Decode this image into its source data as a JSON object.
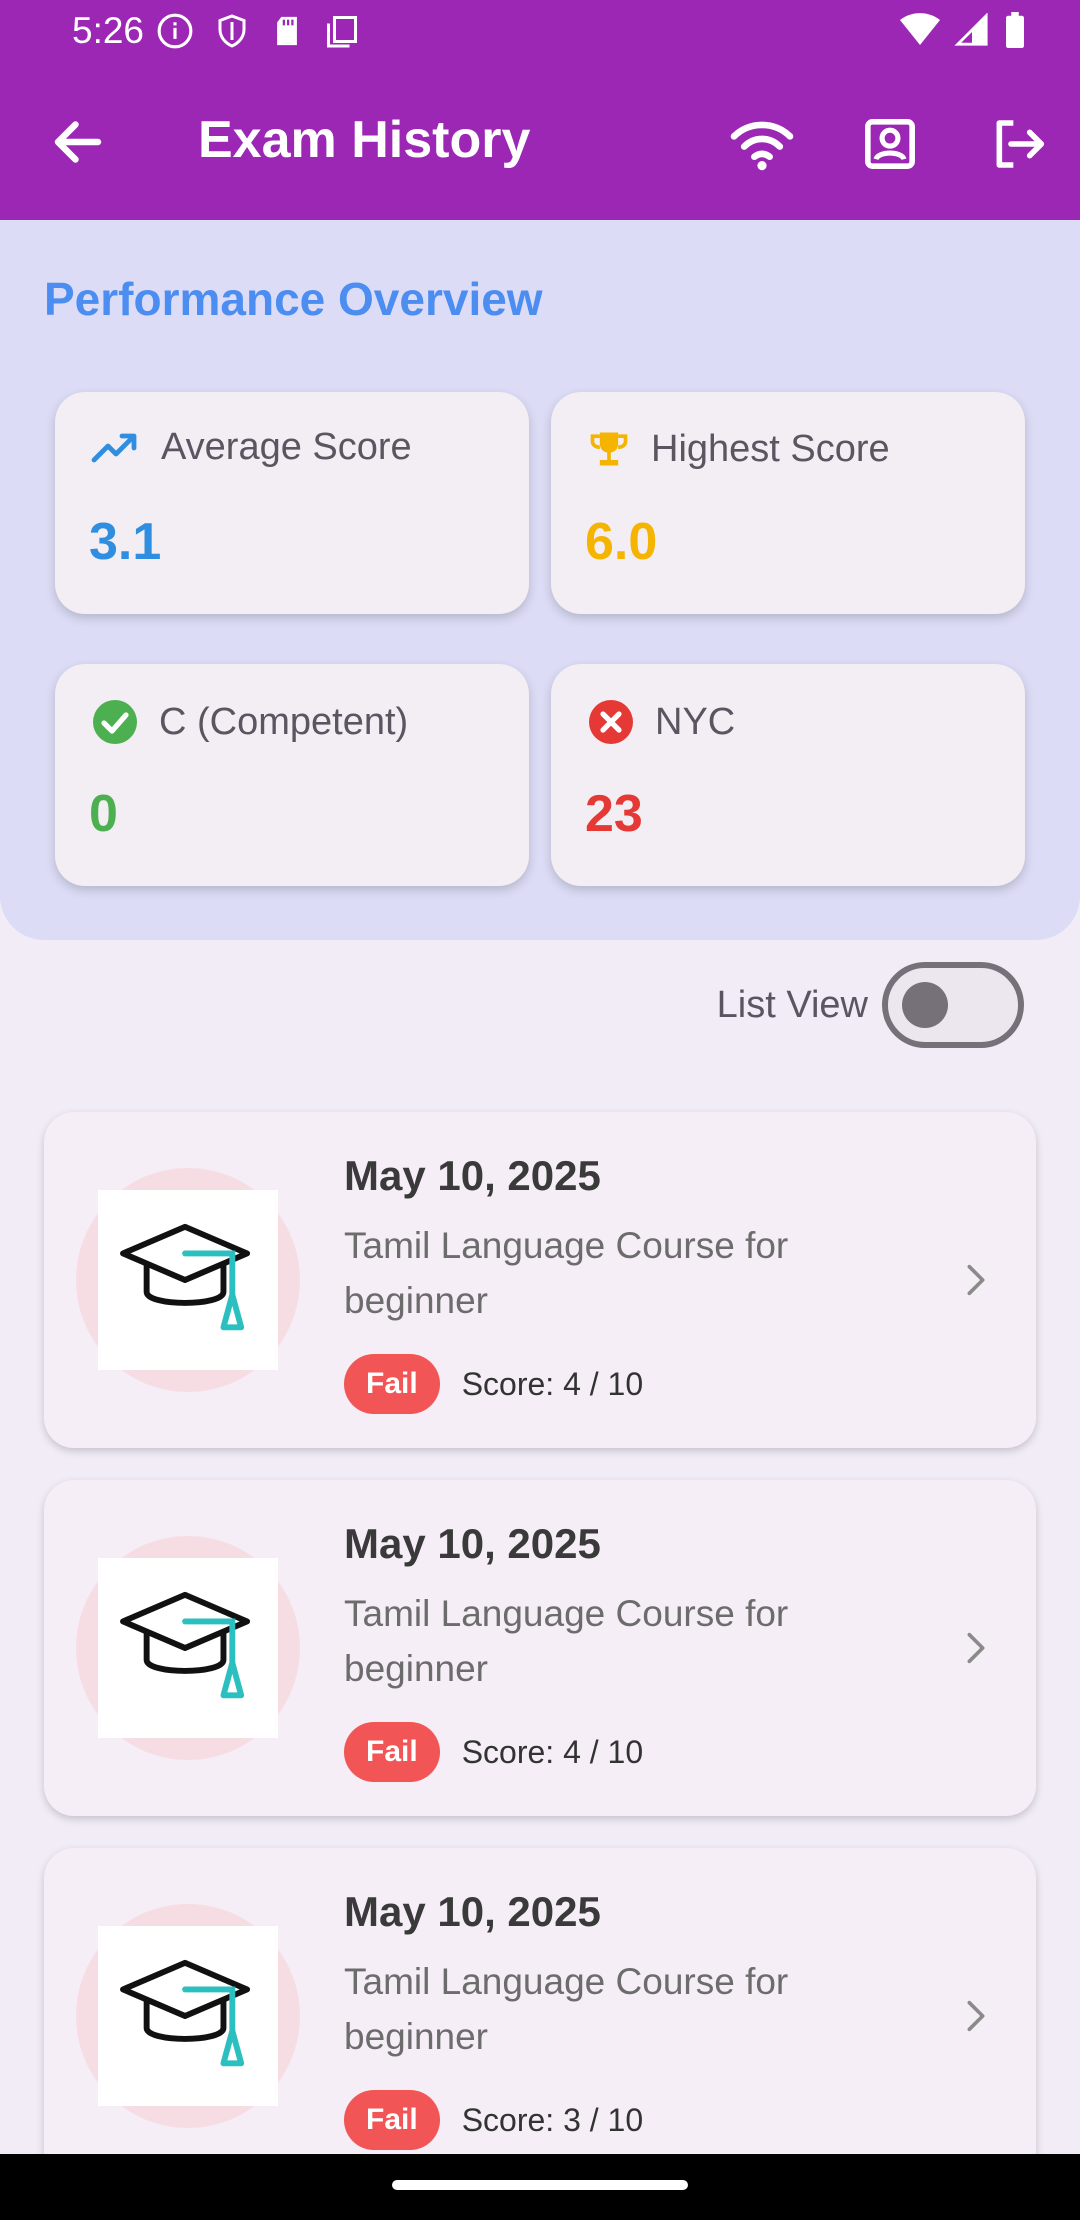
{
  "status_bar": {
    "time": "5:26",
    "left_icons": [
      "info-icon",
      "shield-icon",
      "sd-card-icon",
      "copy-icon"
    ],
    "right_icons": [
      "wifi-icon",
      "signal-icon",
      "battery-icon"
    ]
  },
  "app_bar": {
    "title": "Exam History",
    "back_icon": "arrow-back-icon",
    "actions": [
      "wifi-icon",
      "profile-icon",
      "logout-icon"
    ],
    "color": "#9b27b4"
  },
  "overview": {
    "title": "Performance Overview",
    "stats": [
      {
        "label": "Average Score",
        "value": "3.1",
        "icon": "trending-up-icon",
        "color": "#2f8ee0"
      },
      {
        "label": "Highest Score",
        "value": "6.0",
        "icon": "trophy-icon",
        "color": "#f4b400"
      },
      {
        "label": "C (Competent)",
        "value": "0",
        "icon": "check-circle-icon",
        "color": "#4caf50"
      },
      {
        "label": "NYC",
        "value": "23",
        "icon": "cancel-circle-icon",
        "color": "#e53935"
      }
    ]
  },
  "view_toggle": {
    "label": "List View",
    "on": false
  },
  "exams": [
    {
      "date": "May 10, 2025",
      "course": "Tamil Language Course for beginner",
      "status": "Fail",
      "score": "Score: 4 / 10"
    },
    {
      "date": "May 10, 2025",
      "course": "Tamil Language Course for beginner",
      "status": "Fail",
      "score": "Score: 4 / 10"
    },
    {
      "date": "May 10, 2025",
      "course": "Tamil Language Course for beginner",
      "status": "Fail",
      "score": "Score: 3 / 10"
    }
  ]
}
